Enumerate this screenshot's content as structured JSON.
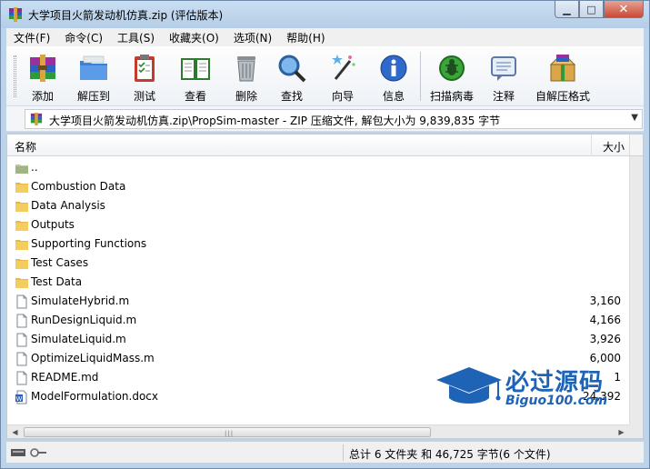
{
  "window": {
    "title": "大学项目火箭发动机仿真.zip (评估版本)"
  },
  "menu": [
    "文件(F)",
    "命令(C)",
    "工具(S)",
    "收藏夹(O)",
    "选项(N)",
    "帮助(H)"
  ],
  "toolbar": {
    "add": "添加",
    "extract": "解压到",
    "test": "测试",
    "view": "查看",
    "delete": "删除",
    "find": "查找",
    "wizard": "向导",
    "info": "信息",
    "scan": "扫描病毒",
    "comment": "注释",
    "sfx": "自解压格式"
  },
  "address": {
    "path": "大学项目火箭发动机仿真.zip\\PropSim-master - ZIP 压缩文件, 解包大小为 9,839,835 字节"
  },
  "columns": {
    "name": "名称",
    "size": "大小"
  },
  "files": [
    {
      "name": "..",
      "size": "",
      "kind": "up"
    },
    {
      "name": "Combustion Data",
      "size": "",
      "kind": "folder"
    },
    {
      "name": "Data Analysis",
      "size": "",
      "kind": "folder"
    },
    {
      "name": "Outputs",
      "size": "",
      "kind": "folder"
    },
    {
      "name": "Supporting Functions",
      "size": "",
      "kind": "folder"
    },
    {
      "name": "Test Cases",
      "size": "",
      "kind": "folder"
    },
    {
      "name": "Test Data",
      "size": "",
      "kind": "folder"
    },
    {
      "name": "SimulateHybrid.m",
      "size": "3,160",
      "kind": "file"
    },
    {
      "name": "RunDesignLiquid.m",
      "size": "4,166",
      "kind": "file"
    },
    {
      "name": "SimulateLiquid.m",
      "size": "3,926",
      "kind": "file"
    },
    {
      "name": "OptimizeLiquidMass.m",
      "size": "6,000",
      "kind": "file"
    },
    {
      "name": "README.md",
      "size": "1",
      "kind": "file"
    },
    {
      "name": "ModelFormulation.docx",
      "size": "24,392",
      "kind": "doc"
    }
  ],
  "watermark": {
    "brand": "必过源码",
    "url": "Biguo100.com"
  },
  "status": {
    "summary": "总计 6 文件夹 和 46,725 字节(6 个文件)"
  }
}
